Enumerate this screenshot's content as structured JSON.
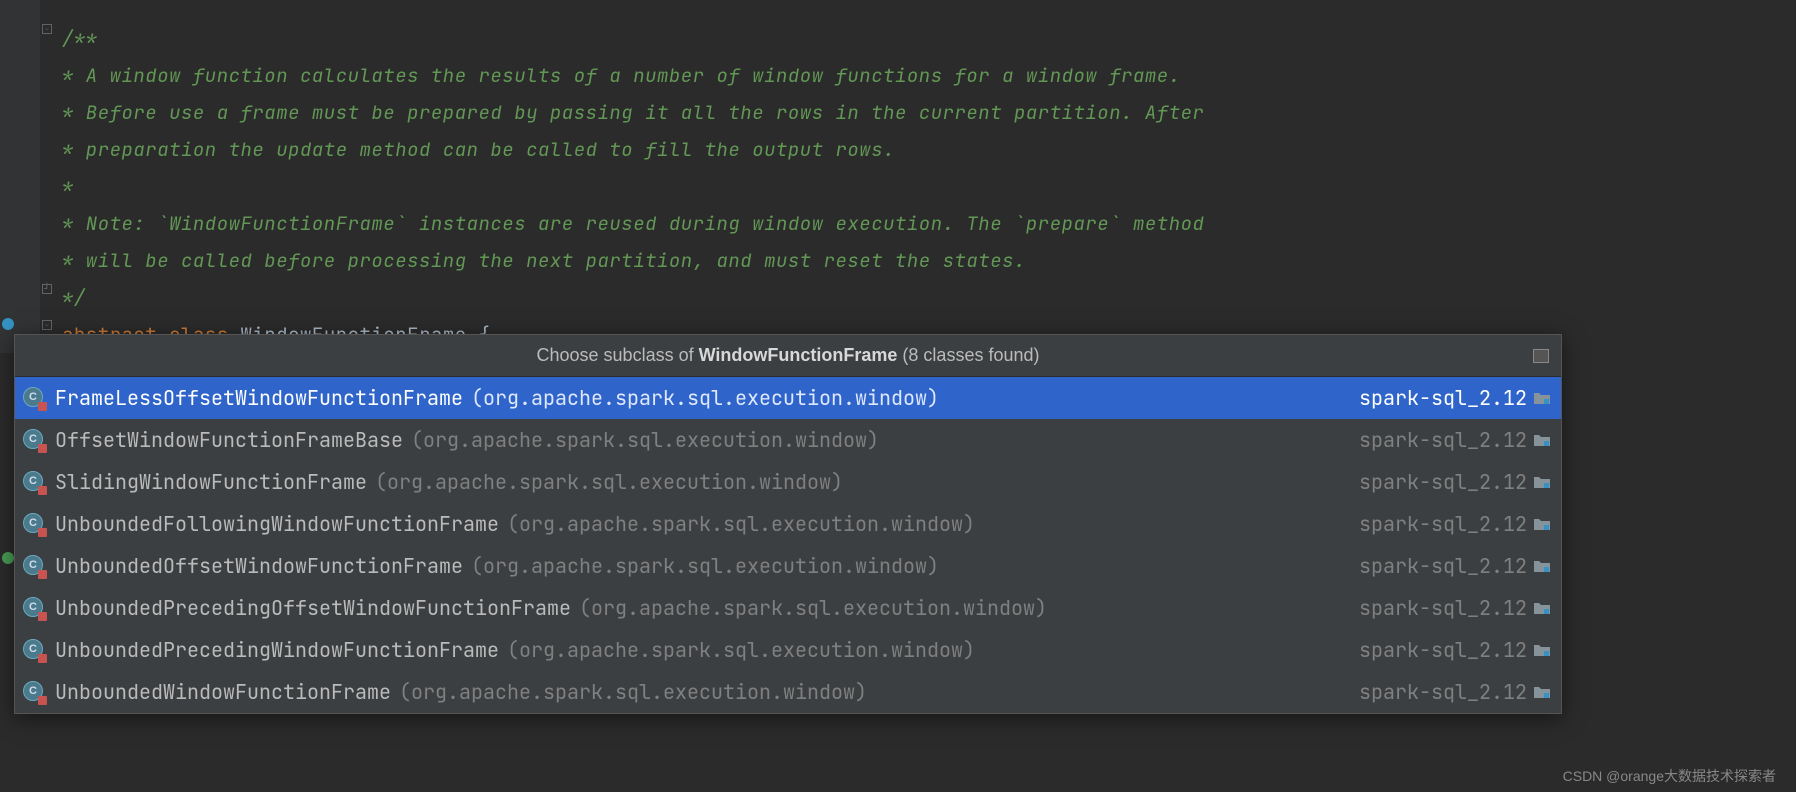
{
  "code": {
    "doc_start": "/**",
    "doc_line1": " * A window function calculates the results of a number of window functions for a window frame.",
    "doc_line2": " * Before use a frame must be prepared by passing it all the rows in the current partition. After",
    "doc_line3": " * preparation the update method can be called to fill the output rows.",
    "doc_line4": " *",
    "doc_line5": " * Note: `WindowFunctionFrame` instances are reused during window execution. The `prepare` method",
    "doc_line6": " * will be called before processing the next partition, and must reset the states.",
    "doc_end": " */",
    "kw_abstract": "abstract",
    "kw_class": "class",
    "class_name": "WindowFunctionFrame",
    "brace": "{"
  },
  "popup": {
    "header_prefix": "Choose subclass of ",
    "header_bold": "WindowFunctionFrame",
    "header_suffix": " (8 classes found)",
    "items": [
      {
        "name": "FrameLessOffsetWindowFunctionFrame",
        "pkg": "(org.apache.spark.sql.execution.window)",
        "module": "spark-sql_2.12",
        "selected": true
      },
      {
        "name": "OffsetWindowFunctionFrameBase",
        "pkg": "(org.apache.spark.sql.execution.window)",
        "module": "spark-sql_2.12",
        "selected": false
      },
      {
        "name": "SlidingWindowFunctionFrame",
        "pkg": "(org.apache.spark.sql.execution.window)",
        "module": "spark-sql_2.12",
        "selected": false
      },
      {
        "name": "UnboundedFollowingWindowFunctionFrame",
        "pkg": "(org.apache.spark.sql.execution.window)",
        "module": "spark-sql_2.12",
        "selected": false
      },
      {
        "name": "UnboundedOffsetWindowFunctionFrame",
        "pkg": "(org.apache.spark.sql.execution.window)",
        "module": "spark-sql_2.12",
        "selected": false
      },
      {
        "name": "UnboundedPrecedingOffsetWindowFunctionFrame",
        "pkg": "(org.apache.spark.sql.execution.window)",
        "module": "spark-sql_2.12",
        "selected": false
      },
      {
        "name": "UnboundedPrecedingWindowFunctionFrame",
        "pkg": "(org.apache.spark.sql.execution.window)",
        "module": "spark-sql_2.12",
        "selected": false
      },
      {
        "name": "UnboundedWindowFunctionFrame",
        "pkg": "(org.apache.spark.sql.execution.window)",
        "module": "spark-sql_2.12",
        "selected": false
      }
    ]
  },
  "watermark": "CSDN @orange大数据技术探索者"
}
